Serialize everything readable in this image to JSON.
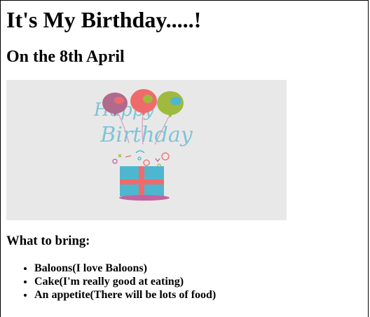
{
  "page": {
    "title": "It's My Birthday.....!",
    "date_heading": "On the 8th April",
    "list_heading": "What to bring:",
    "items": [
      "Baloons(I love Baloons)",
      "Cake(I'm really good at eating)",
      "An appetite(There will be lots of food)"
    ]
  },
  "image": {
    "greeting_line1": "Happy",
    "greeting_line2": "Birthday",
    "icon": "birthday-card-illustration",
    "colors": {
      "background": "#e8e8e8",
      "text": "#7fc4d8",
      "balloon_purple": "#b06a8e",
      "balloon_red": "#ef6b6b",
      "balloon_green": "#9fba3f",
      "gift_box": "#4fb6cf",
      "gift_ribbon": "#ef6b6b",
      "plate": "#c263a0"
    }
  }
}
